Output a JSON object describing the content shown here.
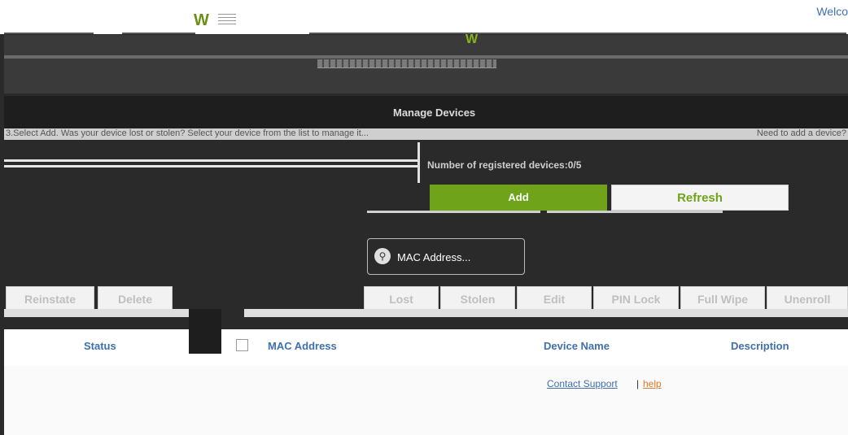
{
  "header": {
    "welcome_text": "Welco"
  },
  "page": {
    "title": "Manage Devices",
    "instructions_left": "3.Select Add. Was your device lost or stolen? Select your device from the list to manage it...",
    "instructions_right": "Need to add a device?",
    "device_count_text": "Number of registered devices:0/5"
  },
  "buttons": {
    "add": "Add",
    "refresh": "Refresh"
  },
  "search": {
    "placeholder": "MAC Address..."
  },
  "actions": [
    "Reinstate",
    "Delete",
    "Lost",
    "Stolen",
    "Edit",
    "PIN Lock",
    "Full Wipe",
    "Unenroll"
  ],
  "table": {
    "columns": [
      "Status",
      "MAC Address",
      "Device Name",
      "Description"
    ]
  },
  "footer": {
    "contact": "Contact Support",
    "separator": "|",
    "help": "help"
  },
  "colors": {
    "accent_green": "#6fa31a",
    "link_blue": "#3f6faf",
    "help_orange": "#e07b2a"
  }
}
